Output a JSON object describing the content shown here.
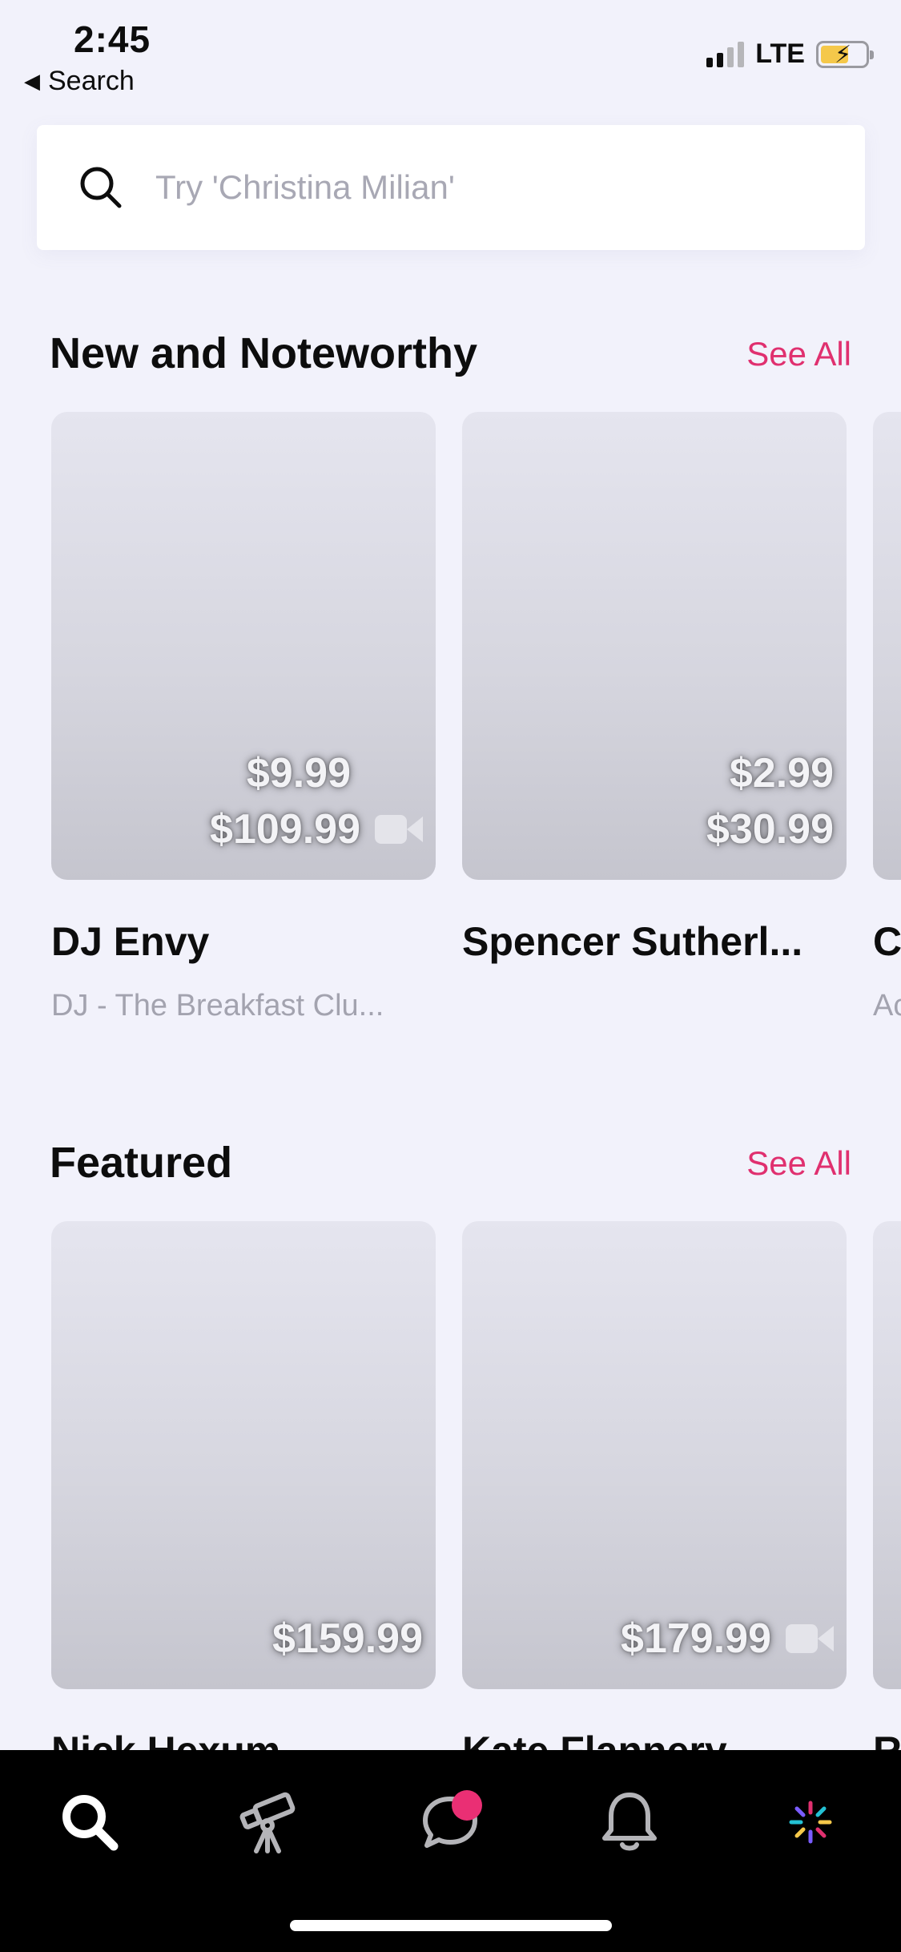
{
  "status_bar": {
    "time": "2:45",
    "back_label": "Search",
    "network": "LTE"
  },
  "search": {
    "placeholder": "Try 'Christina Milian'"
  },
  "sections": [
    {
      "title": "New and Noteworthy",
      "see_all": "See All",
      "cards": [
        {
          "name": "DJ Envy",
          "subtitle": "DJ - The Breakfast Clu...",
          "prices": [
            "$9.99",
            "$109.99"
          ],
          "video": true
        },
        {
          "name": "Spencer Sutherl...",
          "subtitle": "",
          "prices": [
            "$2.99",
            "$30.99"
          ],
          "video": false
        },
        {
          "name": "C",
          "subtitle": "Ac",
          "prices": [],
          "video": false
        }
      ]
    },
    {
      "title": "Featured",
      "see_all": "See All",
      "cards": [
        {
          "name": "Nick Hexum",
          "subtitle": "",
          "prices": [
            "$159.99"
          ],
          "video": false
        },
        {
          "name": "Kate Flannery",
          "subtitle": "",
          "prices": [
            "$179.99"
          ],
          "video": true
        },
        {
          "name": "R",
          "subtitle": "",
          "prices": [],
          "video": false
        }
      ]
    }
  ],
  "tabbar": {
    "tabs": [
      {
        "icon": "search-icon",
        "active": true
      },
      {
        "icon": "telescope-icon",
        "active": false
      },
      {
        "icon": "chat-bubble-icon",
        "active": false,
        "badge": true
      },
      {
        "icon": "bell-icon",
        "active": false
      },
      {
        "icon": "sparkle-logo-icon",
        "active": false
      }
    ],
    "accent": "#EA2F74"
  },
  "colors": {
    "background": "#F2F2FB",
    "accent": "#E0306F"
  }
}
